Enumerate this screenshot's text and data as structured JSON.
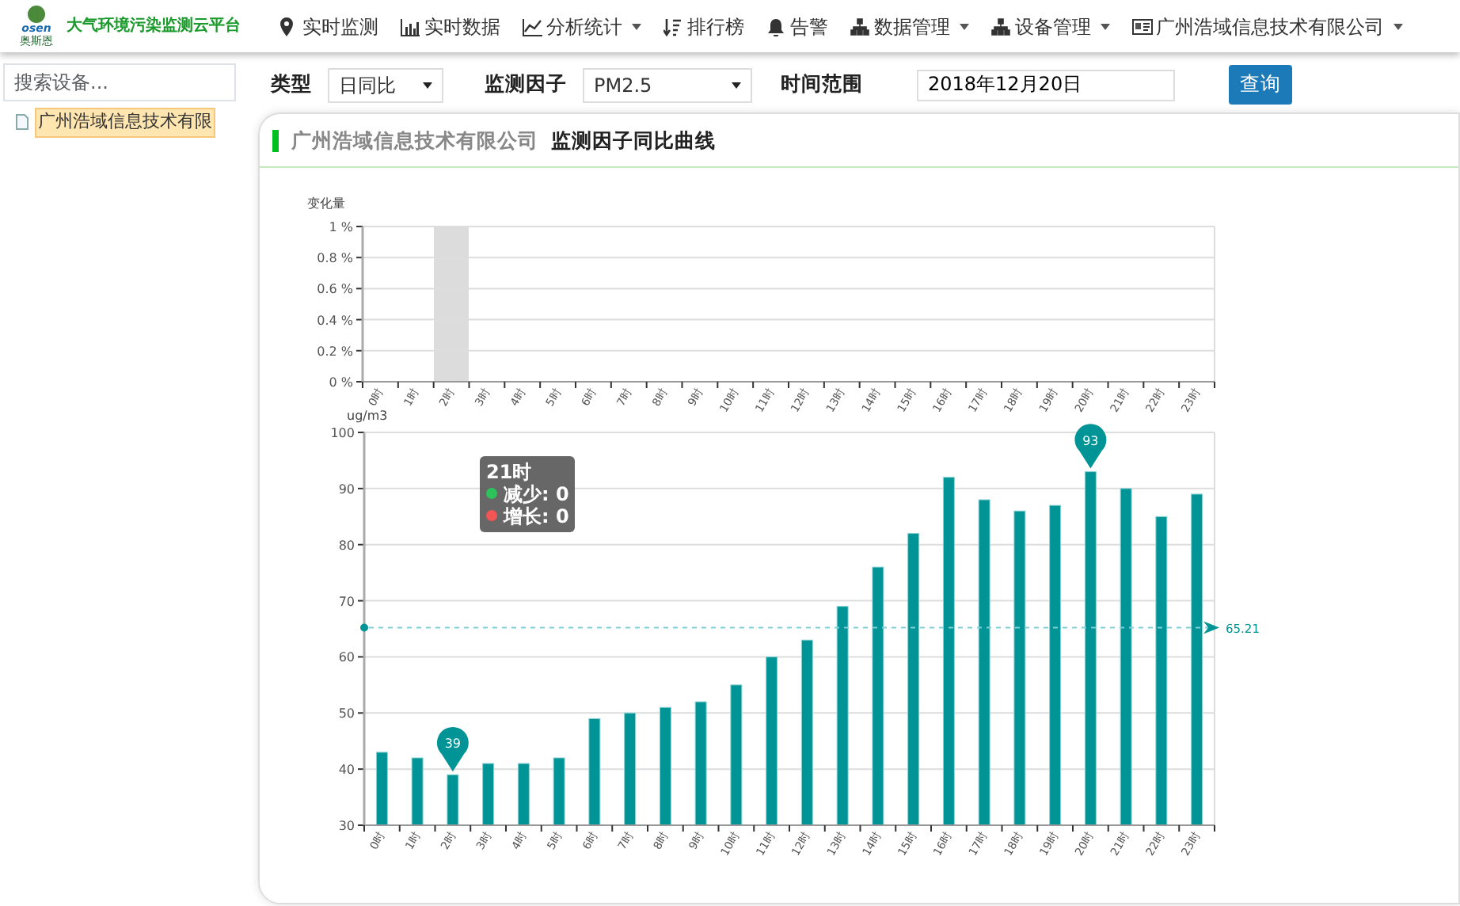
{
  "logo": {
    "brand": "osen",
    "name": "奥斯恩",
    "title": "大气环境污染监测云平台"
  },
  "nav": [
    {
      "label": "实时监测",
      "has_menu": false
    },
    {
      "label": "实时数据",
      "has_menu": false
    },
    {
      "label": "分析统计",
      "has_menu": true
    },
    {
      "label": "排行榜",
      "has_menu": false
    },
    {
      "label": "告警",
      "has_menu": false
    },
    {
      "label": "数据管理",
      "has_menu": true
    },
    {
      "label": "设备管理",
      "has_menu": true
    },
    {
      "label": "广州浩域信息技术有限公司",
      "has_menu": true
    }
  ],
  "sidebar": {
    "search": {
      "placeholder": "搜索设备..."
    },
    "items": [
      {
        "label": "广州浩域信息技术有限",
        "selected": true
      }
    ]
  },
  "filters": {
    "type": {
      "label": "类型",
      "value": "日同比"
    },
    "factor": {
      "label": "监测因子",
      "value": "PM2.5"
    },
    "range": {
      "label": "时间范围",
      "value": "2018年12月20日"
    },
    "button": "查询"
  },
  "panel": {
    "company": "广州浩域信息技术有限公司",
    "title": "监测因子同比曲线"
  },
  "change_chart": {
    "chart_data": {
      "type": "bar",
      "ylabel": "变化量",
      "grid": true,
      "categories": [
        "0时",
        "1时",
        "2时",
        "3时",
        "4时",
        "5时",
        "6时",
        "7时",
        "8时",
        "9时",
        "10时",
        "11时",
        "12时",
        "13时",
        "14时",
        "15时",
        "16时",
        "17时",
        "18时",
        "19时",
        "20时",
        "21时",
        "22时",
        "23时"
      ],
      "series": [
        {
          "color": "#2ec25b",
          "values": [
            0,
            0,
            0,
            0,
            0,
            0,
            0,
            0,
            0,
            0,
            0,
            0,
            0,
            0,
            0,
            0,
            0,
            0,
            0,
            0,
            0,
            0,
            0,
            0
          ]
        },
        {
          "color": "#f25555",
          "values": [
            0,
            0,
            0,
            0,
            0,
            0,
            0,
            0,
            0,
            0,
            0,
            0,
            0,
            0,
            0,
            0,
            0,
            0,
            0,
            0,
            0,
            0,
            0,
            0
          ]
        }
      ],
      "ylim": [
        0,
        1
      ],
      "yticks": [
        {
          "value": 0,
          "label": "0 %"
        },
        {
          "value": 0.2,
          "label": "0.2 %"
        },
        {
          "value": 0.4,
          "label": "0.4 %"
        },
        {
          "value": 0.6,
          "label": "0.6 %"
        },
        {
          "value": 0.8,
          "label": "0.8 %"
        },
        {
          "value": 1,
          "label": "1 %"
        }
      ]
    },
    "tooltip": {
      "title": "21时",
      "items": [
        {
          "label": "减少: 0"
        },
        {
          "label": "增长: 0"
        }
      ]
    }
  },
  "value_chart": {
    "chart_data": {
      "type": "bar",
      "ylabel": "ug/m3",
      "grid": true,
      "categories": [
        "0时",
        "1时",
        "2时",
        "3时",
        "4时",
        "5时",
        "6时",
        "7时",
        "8时",
        "9时",
        "10时",
        "11时",
        "12时",
        "13时",
        "14时",
        "15时",
        "16时",
        "17时",
        "18时",
        "19时",
        "20时",
        "21时",
        "22时",
        "23时"
      ],
      "series": [
        {
          "color": "#009496",
          "values": [
            43,
            42,
            39,
            41,
            41,
            42,
            49,
            50,
            51,
            52,
            55,
            60,
            63,
            69,
            76,
            82,
            92,
            88,
            86,
            87,
            93,
            90,
            85,
            89
          ]
        }
      ],
      "ylim": [
        30,
        100
      ],
      "yticks": [
        30,
        40,
        50,
        60,
        70,
        80,
        90,
        100
      ],
      "annotations": [
        {
          "text": "93",
          "x": "20时",
          "y": 93
        },
        {
          "text": "39",
          "x": "2时",
          "y": 39
        }
      ],
      "ref_lines": [
        {
          "axis": "y",
          "value": 65.21,
          "label": "65.21"
        }
      ]
    }
  }
}
